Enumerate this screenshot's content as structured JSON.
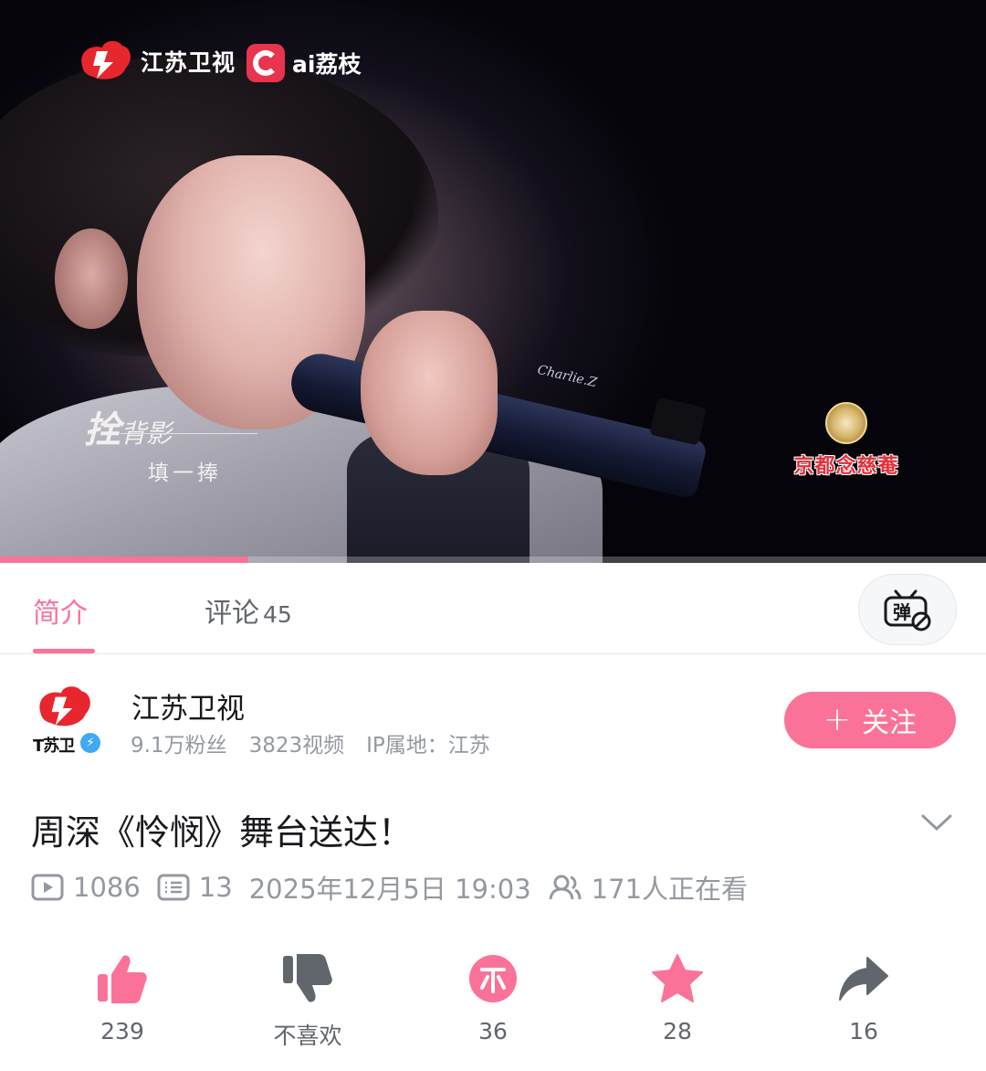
{
  "player": {
    "channel_logo_text": "江苏卫视",
    "app_logo_text": "ai荔枝",
    "song_caption_line1_big": "拴",
    "song_caption_line1": "背影",
    "song_caption_line2": "填一捧",
    "mic_brand": "Charlie.Z",
    "sponsor_name": "京都念慈菴",
    "progress": 0.252
  },
  "tabs": {
    "intro_label": "简介",
    "comments_label": "评论",
    "comments_count": "45",
    "danmaku_icon": "danmaku-off-icon"
  },
  "uploader": {
    "name": "江苏卫视",
    "avatar_text": "T苏卫",
    "fans": "9.1万粉丝",
    "videos": "3823视频",
    "ip": "IP属地：江苏",
    "follow_label": "关注"
  },
  "video": {
    "title": "周深《怜悯》舞台送达！",
    "plays": "1086",
    "danmaku_count": "13",
    "publish_time": "2025年12月5日 19:03",
    "watching": "171人正在看"
  },
  "actions": {
    "like": "239",
    "dislike": "不喜欢",
    "coin": "36",
    "favorite": "28",
    "share": "16"
  },
  "colors": {
    "accent": "#fb7299",
    "text_secondary": "#9499a0",
    "action_gray": "#61666d"
  }
}
